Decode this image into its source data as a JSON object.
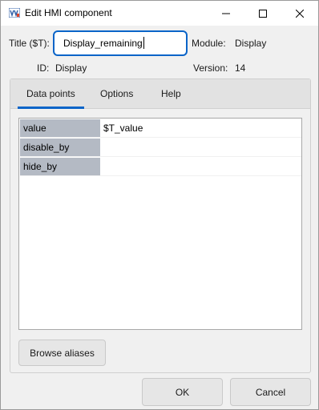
{
  "window": {
    "title": "Edit HMI component"
  },
  "form": {
    "title_label": "Title ($T):",
    "title_value": "Display_remaining",
    "module_label": "Module:",
    "module_value": "Display",
    "id_label": "ID:",
    "id_value": "Display",
    "version_label": "Version:",
    "version_value": "14"
  },
  "tabs": [
    {
      "label": "Data points",
      "selected": true
    },
    {
      "label": "Options",
      "selected": false
    },
    {
      "label": "Help",
      "selected": false
    }
  ],
  "datapoints": [
    {
      "key": "value",
      "value": "$T_value"
    },
    {
      "key": "disable_by",
      "value": ""
    },
    {
      "key": "hide_by",
      "value": ""
    }
  ],
  "buttons": {
    "browse_aliases": "Browse aliases",
    "ok": "OK",
    "cancel": "Cancel"
  },
  "colors": {
    "accent": "#0a64c8",
    "key_cell": "#b4bac4"
  }
}
